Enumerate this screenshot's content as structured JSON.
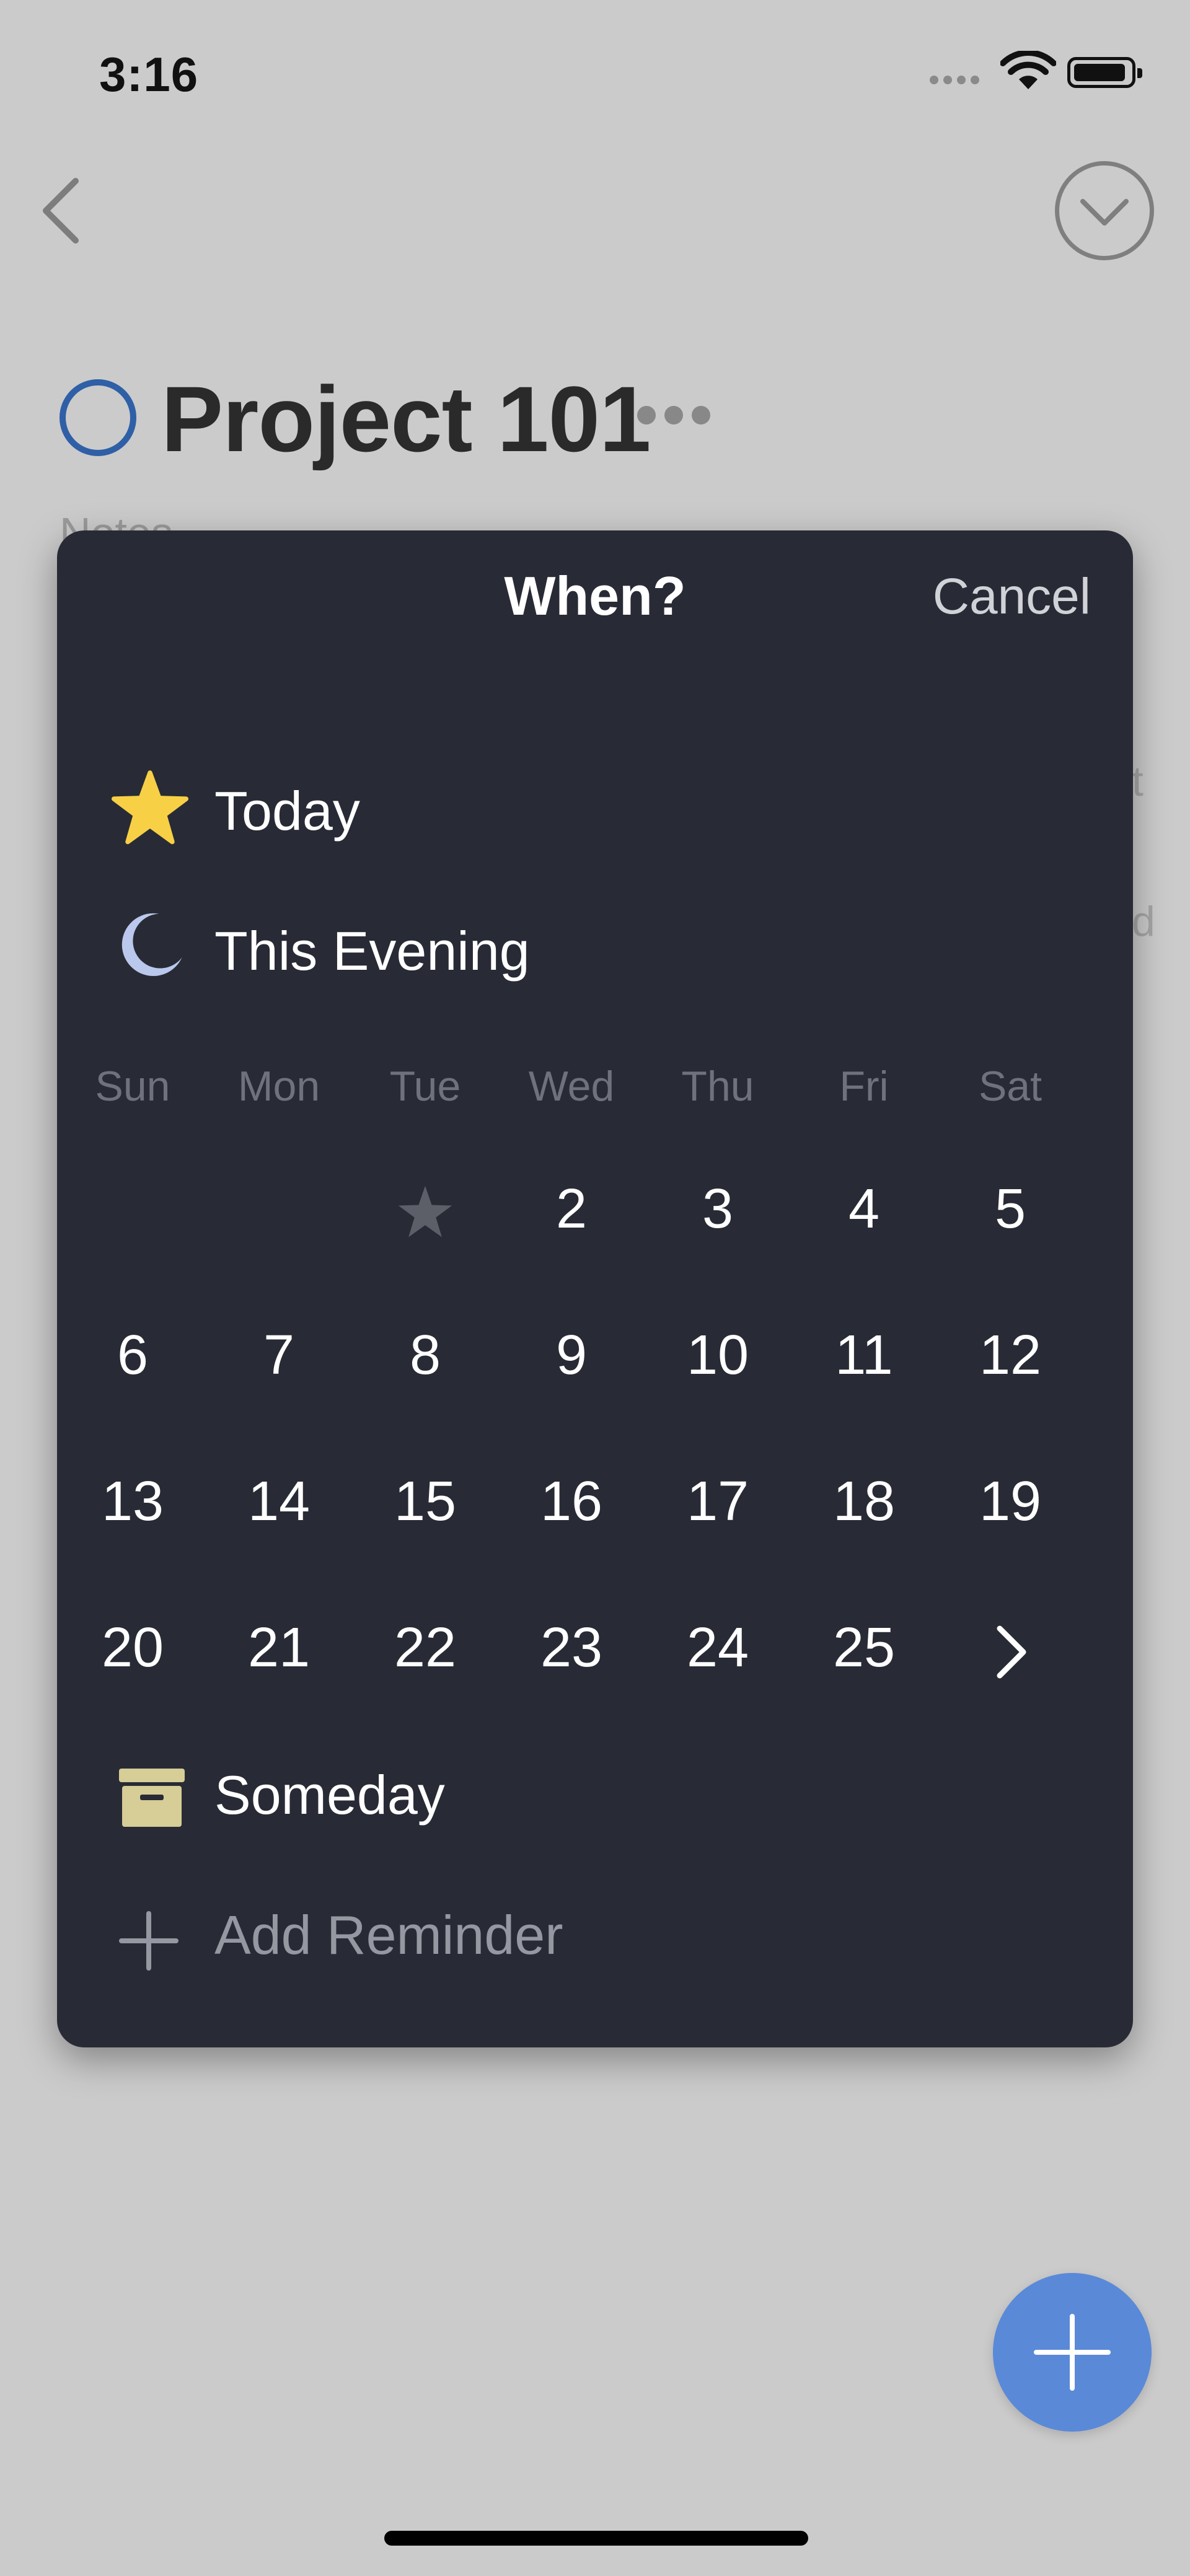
{
  "status_bar": {
    "time": "3:16"
  },
  "project": {
    "title": "Project 101",
    "notes_placeholder": "Notes"
  },
  "background_peek": {
    "line1": "t",
    "line2": "d"
  },
  "modal": {
    "title": "When?",
    "cancel_label": "Cancel",
    "today_label": "Today",
    "evening_label": "This Evening",
    "someday_label": "Someday",
    "add_reminder_label": "Add Reminder",
    "weekdays": [
      "Sun",
      "Mon",
      "Tue",
      "Wed",
      "Thu",
      "Fri",
      "Sat"
    ],
    "calendar_rows": [
      [
        "",
        "",
        "today-star",
        "2",
        "3",
        "4",
        "5"
      ],
      [
        "6",
        "7",
        "8",
        "9",
        "10",
        "11",
        "12"
      ],
      [
        "13",
        "14",
        "15",
        "16",
        "17",
        "18",
        "19"
      ],
      [
        "20",
        "21",
        "22",
        "23",
        "24",
        "25",
        "next-arrow"
      ]
    ]
  },
  "icons": {
    "today": "star-icon",
    "evening": "moon-icon",
    "someday": "archive-box-icon",
    "add_reminder": "plus-icon",
    "next": "chevron-right-icon",
    "back": "chevron-left-icon",
    "menu": "chevron-down-circle-icon",
    "fab": "plus-icon"
  },
  "colors": {
    "background": "#cbcbcb",
    "modal_bg": "#282b35",
    "accent_blue": "#2f5fa6",
    "fab_blue": "#5a89d8",
    "star_yellow": "#f7d046",
    "moon": "#b9c8ec",
    "someday_box": "#d6cd97"
  }
}
